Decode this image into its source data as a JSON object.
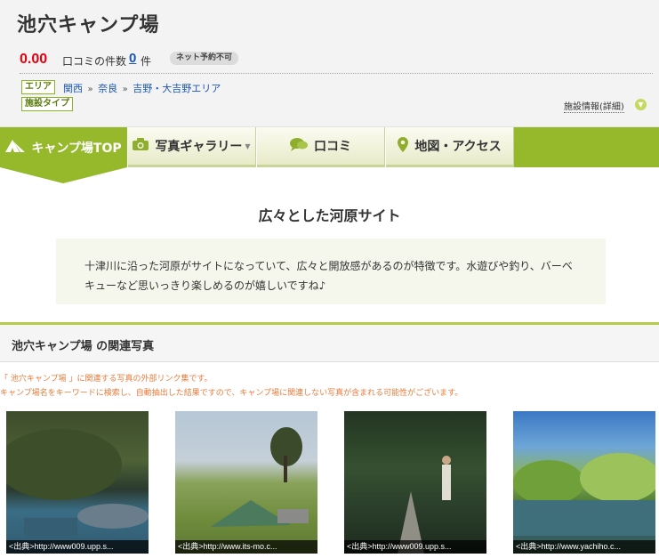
{
  "header": {
    "title": "池穴キャンプ場",
    "rating": "0.00",
    "review_label": "口コミの件数",
    "review_count": "0",
    "review_unit": "件",
    "net_badge": "ネット予約不可",
    "tag_area": "エリア",
    "tag_type": "施設タイプ",
    "breadcrumb": [
      "関西",
      "奈良",
      "吉野・大吉野エリア"
    ],
    "breadcrumb_sep": "»",
    "detail_link": "施設情報(詳細)"
  },
  "nav": {
    "tabs": [
      {
        "label": "キャンプ場TOP",
        "icon": "tent-icon"
      },
      {
        "label": "写真ギャラリー",
        "icon": "camera-icon"
      },
      {
        "label": "口コミ",
        "icon": "chat-icon"
      },
      {
        "label": "地図・アクセス",
        "icon": "map-pin-icon"
      }
    ]
  },
  "feature": {
    "heading": "広々とした河原サイト",
    "text": "十津川に沿った河原がサイトになっていて、広々と開放感があるのが特徴です。水遊びや釣り、バーベキューなど思いっきり楽しめるのが嬉しいですね♪"
  },
  "photos_section": {
    "title": "池穴キャンプ場 の関連写真",
    "note1": "「 池穴キャンプ場 」に関連する写真の外部リンク集です。",
    "note2": "キャンプ場名をキーワードに検索し、自動抽出した結果ですので、キャンプ場に関連しない写真が含まれる可能性がございます。",
    "photos": [
      {
        "caption": "<出典>http://www009.upp.s..."
      },
      {
        "caption": "<出典>http://www.its-mo.c..."
      },
      {
        "caption": "<出典>http://www009.upp.s..."
      },
      {
        "caption": "<出典>http://www.yachiho.c..."
      }
    ]
  },
  "colors": {
    "accent": "#95b92b",
    "rating_red": "#e4000f",
    "link_blue": "#1a56b8",
    "note_orange": "#e87c3c"
  }
}
